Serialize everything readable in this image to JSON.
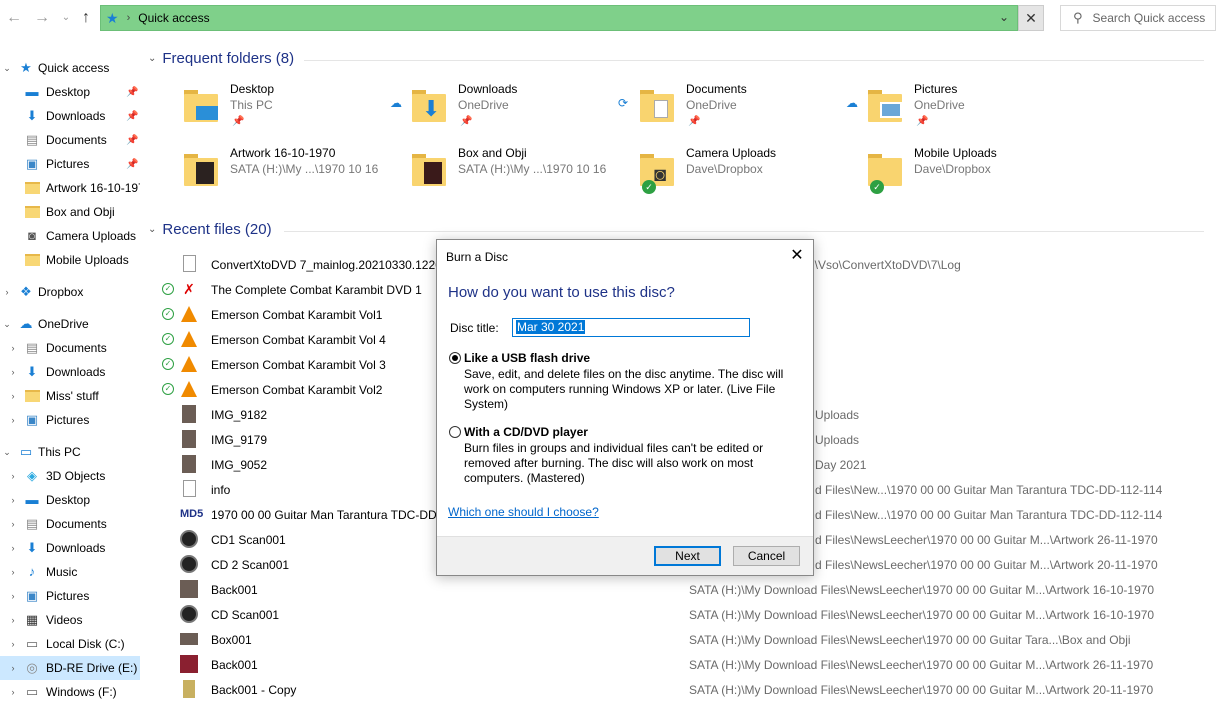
{
  "address": {
    "path": "Quick access",
    "search_placeholder": "Search Quick access"
  },
  "sidebar": {
    "quick_access": "Quick access",
    "quick_items": [
      "Desktop",
      "Downloads",
      "Documents",
      "Pictures",
      "Artwork 16-10-1970",
      "Box and Obji",
      "Camera Uploads",
      "Mobile Uploads"
    ],
    "dropbox": "Dropbox",
    "onedrive": "OneDrive",
    "onedrive_items": [
      "Documents",
      "Downloads",
      "Miss' stuff",
      "Pictures"
    ],
    "this_pc": "This PC",
    "pc_items": [
      "3D Objects",
      "Desktop",
      "Documents",
      "Downloads",
      "Music",
      "Pictures",
      "Videos",
      "Local Disk (C:)",
      "BD-RE Drive (E:)",
      "Windows (F:)"
    ]
  },
  "frequent": {
    "header": "Frequent folders (8)",
    "folders": [
      {
        "name": "Desktop",
        "loc": "This PC"
      },
      {
        "name": "Downloads",
        "loc": "OneDrive"
      },
      {
        "name": "Documents",
        "loc": "OneDrive"
      },
      {
        "name": "Pictures",
        "loc": "OneDrive"
      },
      {
        "name": "Artwork 16-10-1970",
        "loc": "SATA (H:)\\My ...\\1970 10 16"
      },
      {
        "name": "Box and Obji",
        "loc": "SATA (H:)\\My ...\\1970 10 16"
      },
      {
        "name": "Camera Uploads",
        "loc": "Dave\\Dropbox"
      },
      {
        "name": "Mobile Uploads",
        "loc": "Dave\\Dropbox"
      }
    ]
  },
  "recent": {
    "header": "Recent files (20)",
    "files": [
      {
        "name": "ConvertXtoDVD 7_mainlog.20210330.12263",
        "loc": "g\\Vso\\ConvertXtoDVD\\7\\Log"
      },
      {
        "name": "The Complete Combat Karambit DVD 1",
        "loc": ""
      },
      {
        "name": "Emerson Combat Karambit Vol1",
        "loc": ""
      },
      {
        "name": "Emerson Combat Karambit Vol 4",
        "loc": ""
      },
      {
        "name": "Emerson Combat Karambit Vol 3",
        "loc": ""
      },
      {
        "name": "Emerson Combat Karambit Vol2",
        "loc": ""
      },
      {
        "name": "IMG_9182",
        "loc": "Uploads"
      },
      {
        "name": "IMG_9179",
        "loc": "Uploads"
      },
      {
        "name": "IMG_9052",
        "loc": "Day 2021"
      },
      {
        "name": "info",
        "loc": "d Files\\New...\\1970 00 00  Guitar Man Tarantura TDC-DD-112-114"
      },
      {
        "name": "1970 00 00  Guitar Man Tarantura TDC-DD-1",
        "loc": "d Files\\New...\\1970 00 00  Guitar Man Tarantura TDC-DD-112-114"
      },
      {
        "name": "CD1 Scan001",
        "loc": "d Files\\NewsLeecher\\1970 00 00  Guitar M...\\Artwork 26-11-1970"
      },
      {
        "name": "CD 2 Scan001",
        "loc": "d Files\\NewsLeecher\\1970 00 00  Guitar M...\\Artwork 20-11-1970"
      },
      {
        "name": "Back001",
        "loc": "SATA (H:)\\My Download Files\\NewsLeecher\\1970 00 00  Guitar M...\\Artwork 16-10-1970"
      },
      {
        "name": "CD Scan001",
        "loc": "SATA (H:)\\My Download Files\\NewsLeecher\\1970 00 00  Guitar M...\\Artwork 16-10-1970"
      },
      {
        "name": "Box001",
        "loc": "SATA (H:)\\My Download Files\\NewsLeecher\\1970 00 00  Guitar Tara...\\Box and Obji"
      },
      {
        "name": "Back001",
        "loc": "SATA (H:)\\My Download Files\\NewsLeecher\\1970 00 00  Guitar M...\\Artwork 26-11-1970"
      },
      {
        "name": "Back001 - Copy",
        "loc": "SATA (H:)\\My Download Files\\NewsLeecher\\1970 00 00  Guitar M...\\Artwork 20-11-1970"
      }
    ]
  },
  "dialog": {
    "title": "Burn a Disc",
    "heading": "How do you want to use this disc?",
    "disc_title_label": "Disc title:",
    "disc_title_value": "Mar 30 2021",
    "option1_title": "Like a USB flash drive",
    "option1_desc": "Save, edit, and delete files on the disc anytime. The disc will work on computers running Windows XP or later. (Live File System)",
    "option2_title": "With a CD/DVD player",
    "option2_desc": "Burn files in groups and individual files can't be edited or removed after burning. The disc will also work on most computers. (Mastered)",
    "help_link": "Which one should I choose?",
    "next_label": "Next",
    "cancel_label": "Cancel",
    "close_glyph": "✕"
  },
  "colors": {
    "address_bg": "#7fd08a",
    "heading_blue": "#1e3287",
    "accent": "#0078d7"
  }
}
